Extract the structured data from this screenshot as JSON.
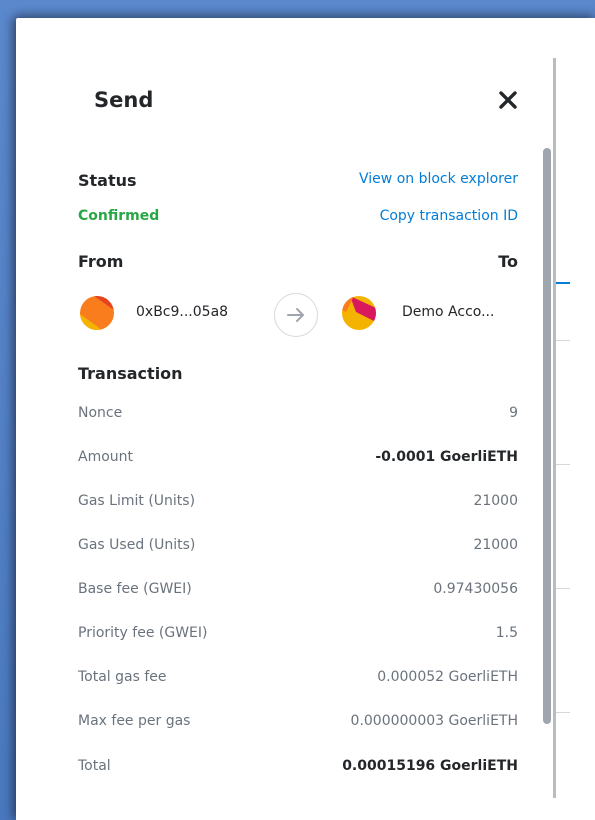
{
  "header": {
    "title": "Send",
    "close_icon": "close-icon"
  },
  "status": {
    "label": "Status",
    "value": "Confirmed",
    "value_color": "#28a745",
    "view_link": "View on block explorer",
    "copy_link": "Copy transaction ID"
  },
  "parties": {
    "from_label": "From",
    "to_label": "To",
    "from_address": "0xBc9...05a8",
    "to_name": "Demo Acco...",
    "arrow_icon": "arrow-right-icon"
  },
  "transaction": {
    "title": "Transaction",
    "rows": [
      {
        "label": "Nonce",
        "value": "9"
      },
      {
        "label": "Amount",
        "value": "-0.0001 GoerliETH"
      },
      {
        "label": "Gas Limit (Units)",
        "value": "21000"
      },
      {
        "label": "Gas Used (Units)",
        "value": "21000"
      },
      {
        "label": "Base fee (GWEI)",
        "value": "0.97430056"
      },
      {
        "label": "Priority fee (GWEI)",
        "value": "1.5"
      },
      {
        "label": "Total gas fee",
        "value": "0.000052 GoerliETH"
      },
      {
        "label": "Max fee per gas",
        "value": "0.000000003 GoerliETH"
      },
      {
        "label": "Total",
        "value": "0.00015196 GoerliETH"
      }
    ]
  },
  "colors": {
    "link": "#037dd6",
    "confirmed": "#28a745",
    "text": "#24272a",
    "muted": "#6a737d",
    "backdrop": "#4f7fc4"
  }
}
